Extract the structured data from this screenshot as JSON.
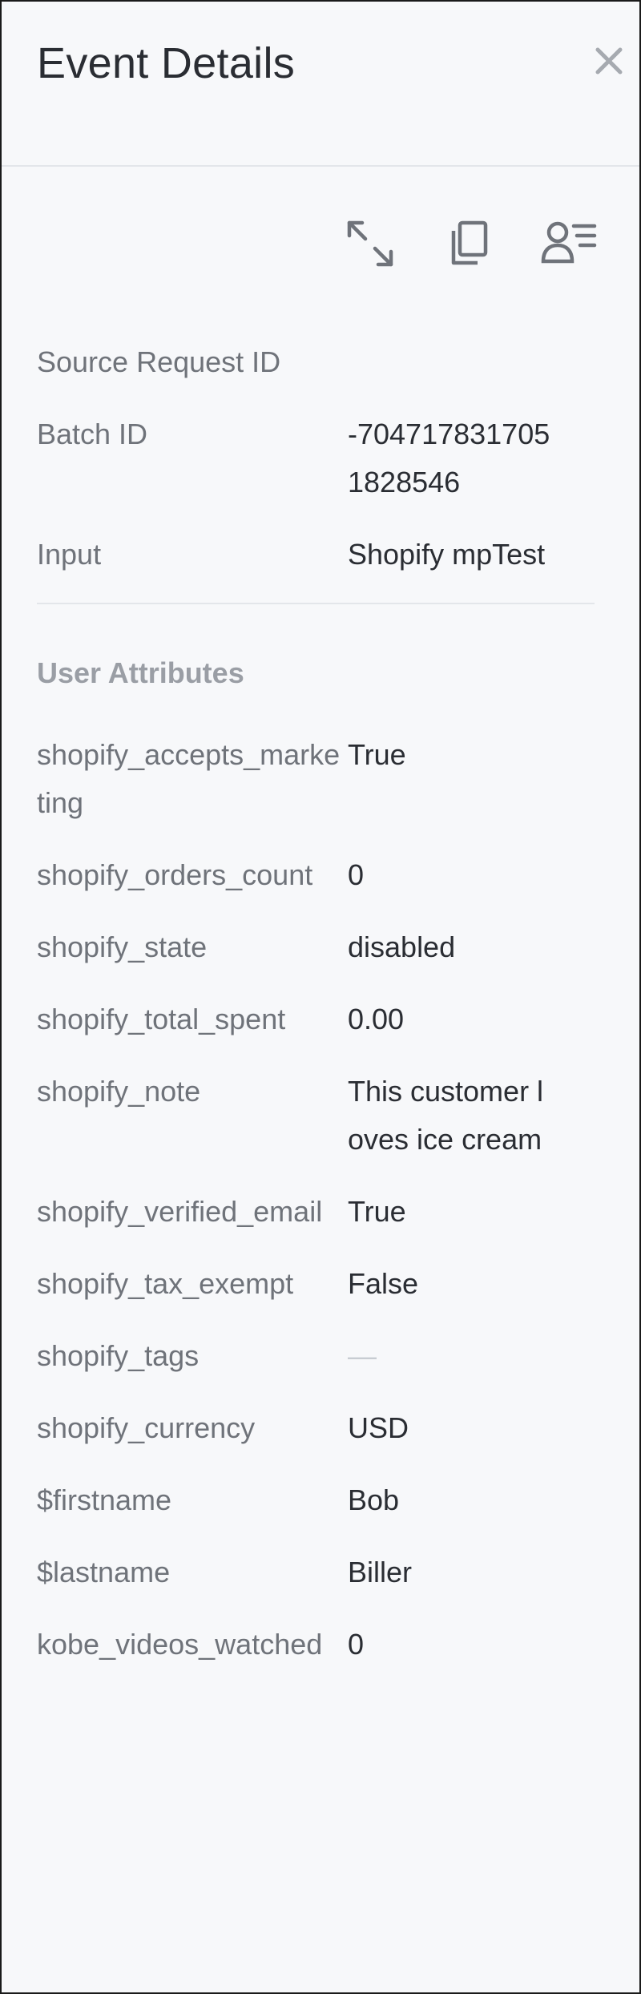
{
  "header": {
    "title": "Event Details"
  },
  "toolbar": {
    "icons": [
      "expand-icon",
      "copy-icon",
      "user-profile-icon"
    ]
  },
  "details": [
    {
      "key": "Source Request ID",
      "value": ""
    },
    {
      "key": "Batch ID",
      "value": "-7047178317051828546"
    },
    {
      "key": "Input",
      "value": "Shopify mpTest"
    }
  ],
  "user_attributes": {
    "title": "User Attributes",
    "items": [
      {
        "key": "shopify_accepts_marketing",
        "value": "True"
      },
      {
        "key": "shopify_orders_count",
        "value": "0"
      },
      {
        "key": "shopify_state",
        "value": "disabled"
      },
      {
        "key": "shopify_total_spent",
        "value": "0.00"
      },
      {
        "key": "shopify_note",
        "value": "This customer loves ice cream"
      },
      {
        "key": "shopify_verified_email",
        "value": "True"
      },
      {
        "key": "shopify_tax_exempt",
        "value": "False"
      },
      {
        "key": "shopify_tags",
        "value": "—"
      },
      {
        "key": "shopify_currency",
        "value": "USD"
      },
      {
        "key": "$firstname",
        "value": "Bob"
      },
      {
        "key": "$lastname",
        "value": "Biller"
      },
      {
        "key": "kobe_videos_watched",
        "value": "0"
      }
    ]
  },
  "colors": {
    "text": "#2a2d33",
    "label": "#6f737a",
    "section": "#9a9ea5",
    "background": "#f7f8fa"
  }
}
